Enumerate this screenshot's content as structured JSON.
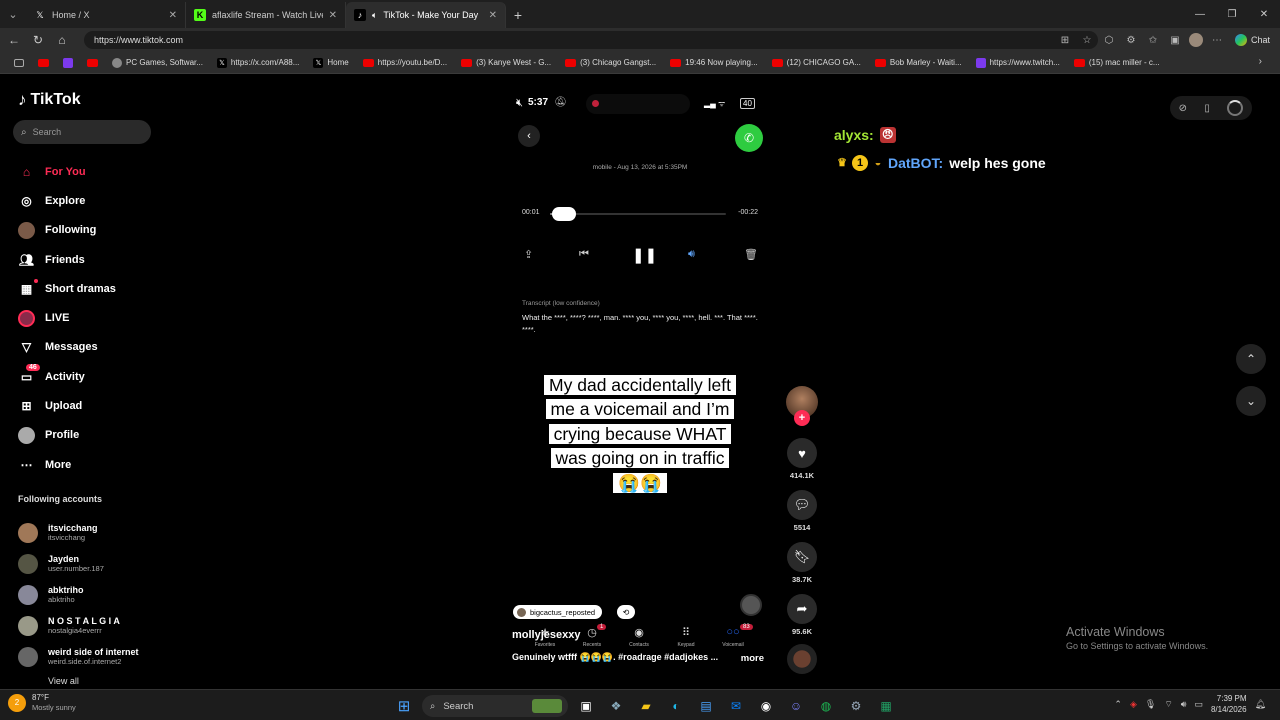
{
  "browser": {
    "tabs": [
      {
        "label": "Home / X",
        "icon": "x-logo-icon"
      },
      {
        "label": "aflaxlife Stream - Watch Live on Ki",
        "icon": "kick-logo-icon"
      },
      {
        "label": "TikTok - Make Your Day",
        "icon": "tiktok-logo-icon",
        "active": true
      }
    ],
    "url": "https://www.tiktok.com",
    "chat_label": "Chat",
    "bookmarks": [
      "",
      "",
      "",
      "PC Games, Softwar...",
      "https://x.com/A88...",
      "Home",
      "https://youtu.be/D...",
      "(3) Kanye West - G...",
      "(3) Chicago Gangst...",
      "19:46 Now playing...",
      "(12) CHICAGO GA...",
      "Bob Marley - Waiti...",
      "https://www.twitch...",
      "(15) mac miller - c..."
    ]
  },
  "tiktok": {
    "logo": "TikTok",
    "search_placeholder": "Search",
    "nav": [
      {
        "label": "For You",
        "icon": "home-icon"
      },
      {
        "label": "Explore",
        "icon": "compass-icon"
      },
      {
        "label": "Following",
        "icon": "following-avatar-icon"
      },
      {
        "label": "Friends",
        "icon": "friends-icon"
      },
      {
        "label": "Short dramas",
        "icon": "film-icon"
      },
      {
        "label": "LIVE",
        "icon": "live-icon"
      },
      {
        "label": "Messages",
        "icon": "messages-icon"
      },
      {
        "label": "Activity",
        "icon": "activity-icon",
        "badge": "46"
      },
      {
        "label": "Upload",
        "icon": "upload-icon"
      },
      {
        "label": "Profile",
        "icon": "profile-icon"
      },
      {
        "label": "More",
        "icon": "more-icon"
      }
    ],
    "following_header": "Following accounts",
    "following": [
      {
        "name": "itsvicchang",
        "user": "itsvicchang"
      },
      {
        "name": "Jayden",
        "user": "user.number.187"
      },
      {
        "name": "abktriho",
        "user": "abktriho"
      },
      {
        "name": "N O S T A L G I A",
        "user": "nostalgia4everrr"
      },
      {
        "name": "weird side of internet",
        "user": "weird.side.of.internet2"
      }
    ],
    "view_all": "View all"
  },
  "video": {
    "phone_time": "5:37",
    "battery": "40",
    "meta": "mobile - Aug 13, 2026 at 5:35PM",
    "time_current": "00:01",
    "time_remaining": "-00:22",
    "progress": 0.045,
    "transcript_header": "Transcript (low confidence)",
    "transcript": "What the ****, ****?  ****, man.  **** you, **** you, ****, hell.  ***.  That ****.  ****.",
    "caption": "My dad accidentally left me a voicemail and I’m crying because WHAT was going on in traffic 😭😭",
    "repost_user": "bigcactus_reposted",
    "author": "mollyjesexxy",
    "description": "Genuinely wtfff 😭😭😭. #roadrage #dadjokes ...",
    "more": "more",
    "phone_tabs": [
      {
        "label": "Favorites",
        "icon": "star-icon"
      },
      {
        "label": "Recents",
        "icon": "clock-icon",
        "badge": "1"
      },
      {
        "label": "Contacts",
        "icon": "contacts-icon"
      },
      {
        "label": "Keypad",
        "icon": "keypad-icon"
      },
      {
        "label": "Voicemail",
        "icon": "voicemail-icon",
        "badge": "83"
      }
    ]
  },
  "actions": {
    "likes": "414.1K",
    "comments": "5514",
    "saves": "38.7K",
    "shares": "95.6K"
  },
  "chat": [
    {
      "user": "alyxs:",
      "message": ""
    },
    {
      "user": "DatBOT:",
      "message": "welp hes gone"
    }
  ],
  "windows": {
    "activate_title": "Activate Windows",
    "activate_sub": "Go to Settings to activate Windows.",
    "weather_temp": "87°F",
    "weather_desc": "Mostly sunny",
    "weather_badge": "2",
    "search": "Search",
    "time": "7:39 PM",
    "date": "8/14/2026"
  }
}
